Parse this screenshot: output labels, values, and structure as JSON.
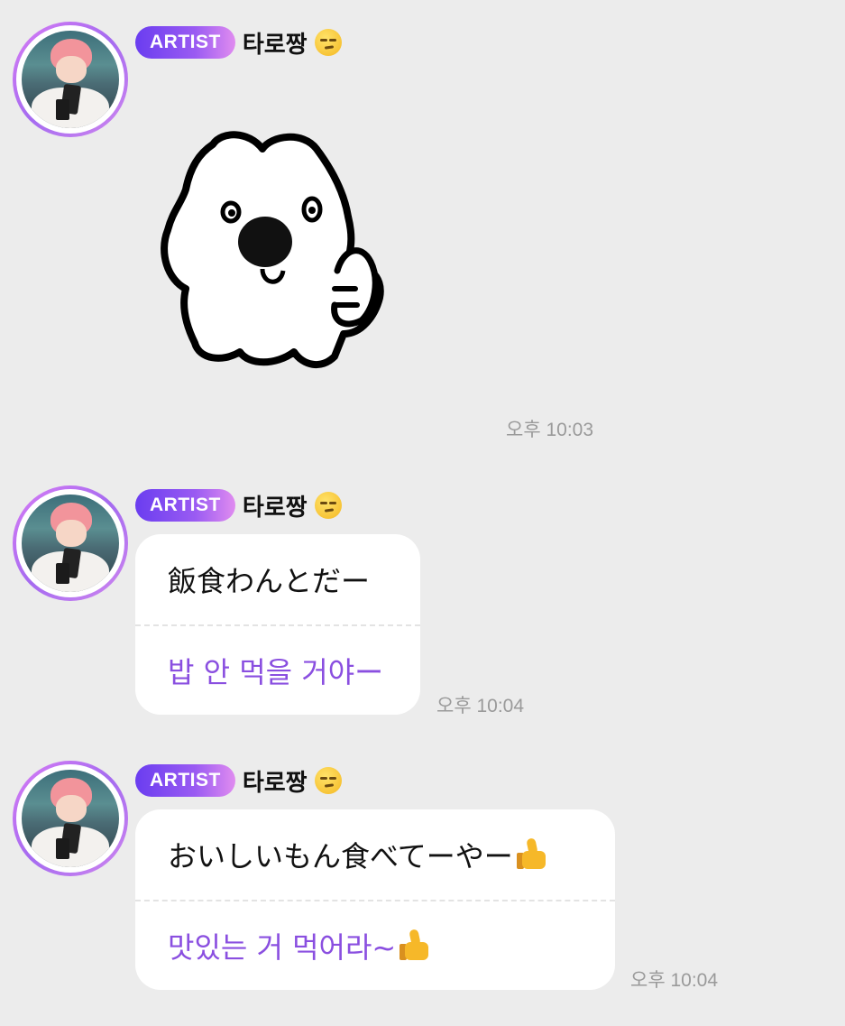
{
  "messages": [
    {
      "badge": "ARTIST",
      "sender": "타로짱",
      "sender_emoji": "smirking-face-icon",
      "type": "sticker",
      "sticker": "dog-thumbs-up-sticker",
      "time": "오후 10:03"
    },
    {
      "badge": "ARTIST",
      "sender": "타로짱",
      "sender_emoji": "smirking-face-icon",
      "type": "text",
      "text": "飯食わんとだー",
      "translation": "밥 안 먹을 거야ー",
      "time": "오후 10:04"
    },
    {
      "badge": "ARTIST",
      "sender": "타로짱",
      "sender_emoji": "smirking-face-icon",
      "type": "text",
      "text": "おいしいもん食べてーやー",
      "text_emoji": "thumbs-up-icon",
      "translation": "맛있는 거 먹어라~",
      "translation_emoji": "thumbs-up-icon",
      "time": "오후 10:04"
    }
  ],
  "colors": {
    "background": "#ececec",
    "badge_start": "#6a3df0",
    "badge_end": "#e08cf0",
    "translation_text": "#8a4fe0",
    "timestamp": "#9a9a9a"
  }
}
